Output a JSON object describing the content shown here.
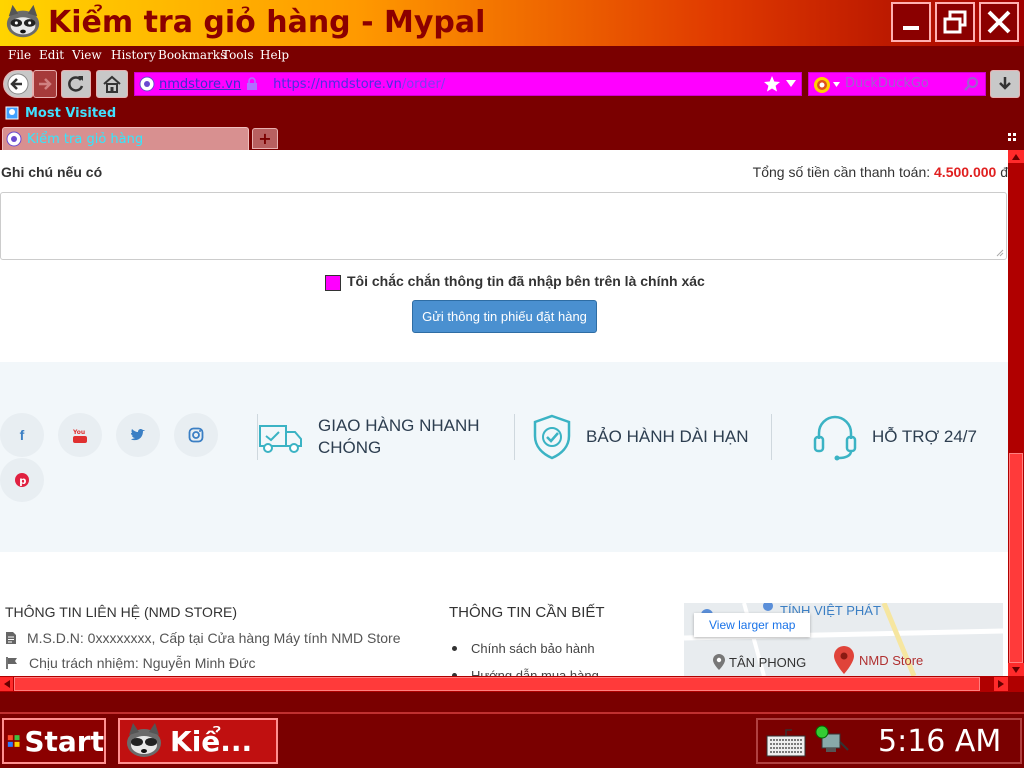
{
  "window": {
    "title": "Kiểm tra giỏ hàng - Mypal",
    "icon": "raccoon-icon"
  },
  "menu": {
    "items": [
      {
        "label": "File"
      },
      {
        "label": "Edit"
      },
      {
        "label": "View"
      },
      {
        "label": "History"
      },
      {
        "label": "Bookmarks"
      },
      {
        "label": "Tools"
      },
      {
        "label": "Help"
      }
    ]
  },
  "nav": {
    "site_badge": "nmdstore.vn",
    "url_host": "https://nmdstore.vn",
    "url_path": "/order/",
    "search_placeholder": "DuckDuckGo"
  },
  "bookmarks": {
    "most_visited": "Most Visited"
  },
  "tabs": [
    {
      "title": "Kiểm tra giỏ hàng"
    }
  ],
  "order": {
    "note_label": "Ghi chú nếu có",
    "total_label": "Tổng số tiền cần thanh toán:",
    "total_amount": "4.500.000",
    "total_currency": "đ",
    "note_value": "",
    "confirm_label": "Tôi chắc chắn thông tin đã nhập bên trên là chính xác",
    "submit_label": "Gửi thông tin phiếu đặt hàng"
  },
  "social": [
    {
      "icon": "facebook-icon",
      "glyph": "f"
    },
    {
      "icon": "youtube-icon",
      "glyph": "You Tube"
    },
    {
      "icon": "twitter-icon",
      "glyph": ""
    },
    {
      "icon": "instagram-icon",
      "glyph": ""
    },
    {
      "icon": "pinterest-icon",
      "glyph": "P"
    }
  ],
  "features": [
    {
      "icon": "delivery-truck-icon",
      "line1": "GIAO HÀNG NHANH",
      "line2": "CHÓNG"
    },
    {
      "icon": "shield-check-icon",
      "line1": "BẢO HÀNH DÀI HẠN",
      "line2": ""
    },
    {
      "icon": "headset-icon",
      "line1": "HỖ TRỢ 24/7",
      "line2": ""
    }
  ],
  "footer": {
    "contact_title": "THÔNG TIN LIÊN HỆ (NMD STORE)",
    "contact_lines": [
      {
        "icon": "document-icon",
        "text": "M.S.D.N: 0xxxxxxxx, Cấp tại Cửa hàng Máy tính NMD Store"
      },
      {
        "icon": "flag-icon",
        "text": "Chịu trách nhiệm: Nguyễn Minh Đức"
      }
    ],
    "info_title": "THÔNG TIN CẦN BIẾT",
    "info_items": [
      {
        "text": "Chính sách bảo hành"
      },
      {
        "text": "Hướng dẫn mua hàng"
      }
    ],
    "map": {
      "link": "View larger map",
      "top_text": "TÍNH VIỆT PHÁT",
      "place1": "TÂN PHONG",
      "place2": "NMD Store"
    }
  },
  "taskbar": {
    "start": "Start",
    "task_label": "Kiể...",
    "clock": "5:16 AM"
  },
  "colors": {
    "chrome": "#7a0000",
    "url_bar": "#ff00ff",
    "price": "#e02020",
    "button": "#4a90d0"
  }
}
